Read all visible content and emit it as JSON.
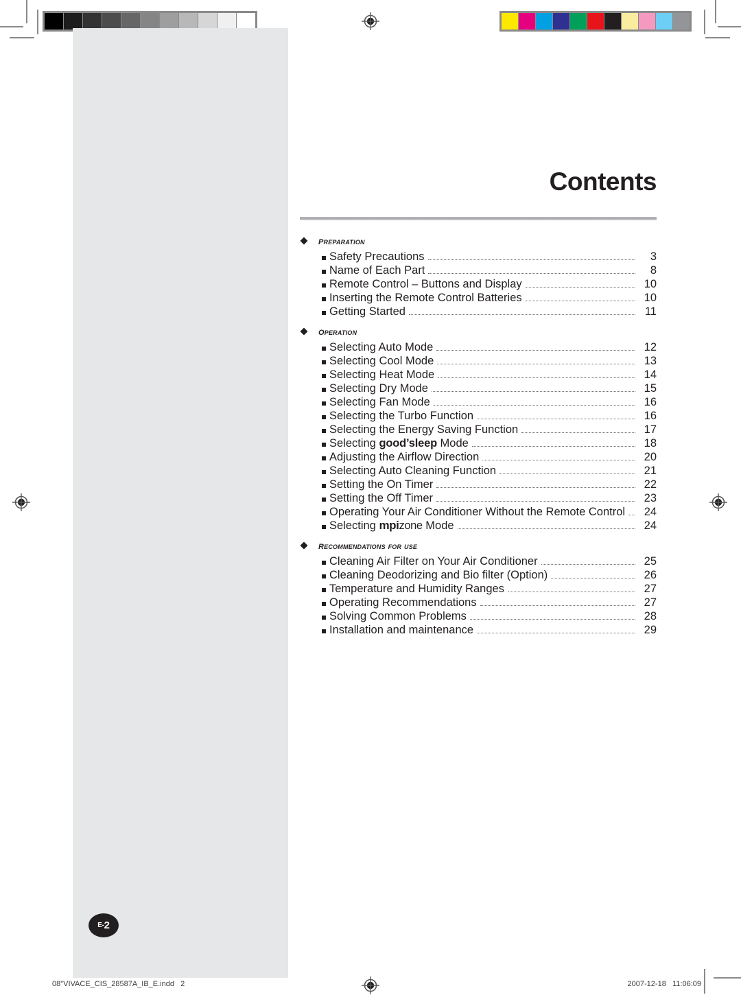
{
  "document": {
    "title": "Contents",
    "page_badge": {
      "prefix": "E-",
      "number": "2"
    }
  },
  "toc": {
    "sections": [
      {
        "label": "Preparation",
        "bullet_icon": "diamond-icon",
        "entries": [
          {
            "text": "Safety Precautions",
            "page": "3"
          },
          {
            "text": "Name of Each Part",
            "page": "8"
          },
          {
            "text": "Remote Control – Buttons and Display",
            "page": "10"
          },
          {
            "text": "Inserting the Remote Control Batteries",
            "page": "10"
          },
          {
            "text": "Getting Started",
            "page": "11"
          }
        ]
      },
      {
        "label": "Operation",
        "bullet_icon": "diamond-icon",
        "entries": [
          {
            "text": "Selecting Auto Mode",
            "page": "12"
          },
          {
            "text": "Selecting Cool Mode",
            "page": "13"
          },
          {
            "text": "Selecting Heat Mode",
            "page": "14"
          },
          {
            "text": "Selecting Dry Mode",
            "page": "15"
          },
          {
            "text": "Selecting Fan Mode",
            "page": "16"
          },
          {
            "text": "Selecting the Turbo Function",
            "page": "16"
          },
          {
            "text": "Selecting the Energy Saving Function",
            "page": "17"
          },
          {
            "text": "Selecting good’sleep Mode",
            "page": "18",
            "brand": "goodsleep"
          },
          {
            "text": "Adjusting the Airflow Direction",
            "page": "20"
          },
          {
            "text": "Selecting Auto Cleaning Function",
            "page": "21"
          },
          {
            "text": "Setting the On Timer",
            "page": "22"
          },
          {
            "text": "Setting the Off Timer",
            "page": "23"
          },
          {
            "text": "Operating Your Air Conditioner Without the Remote Control",
            "page": "24"
          },
          {
            "text": "Selecting mpizone Mode",
            "page": "24",
            "brand": "mpizone"
          }
        ]
      },
      {
        "label": "Recommendations for use",
        "bullet_icon": "diamond-icon",
        "entries": [
          {
            "text": "Cleaning  Air Filter on Your Air Conditioner",
            "page": "25"
          },
          {
            "text": "Cleaning Deodorizing and Bio filter (Option)",
            "page": "26"
          },
          {
            "text": "Temperature and Humidity Ranges",
            "page": "27"
          },
          {
            "text": "Operating Recommendations",
            "page": "27"
          },
          {
            "text": "Solving Common Problems",
            "page": "28"
          },
          {
            "text": "Installation and maintenance",
            "page": "29"
          }
        ]
      }
    ]
  },
  "footer": {
    "file_name": "08\"VIVACE_CIS_28587A_IB_E.indd   2",
    "timestamp": "2007-12-18   11:06:09"
  },
  "prepress": {
    "gray_wedge": [
      "#000000",
      "#1d1d1d",
      "#333333",
      "#4c4c4c",
      "#666666",
      "#858585",
      "#9e9e9e",
      "#b8b8b8",
      "#d6d6d6",
      "#f0f0f0",
      "#ffffff"
    ],
    "color_wedge": [
      "#ffe800",
      "#e6007e",
      "#00a0e3",
      "#2e3192",
      "#00a05a",
      "#e8141c",
      "#231f20",
      "#faeda0",
      "#f49ac1",
      "#6dcff6",
      "#939598"
    ],
    "registration_icon": "registration-target-icon"
  }
}
